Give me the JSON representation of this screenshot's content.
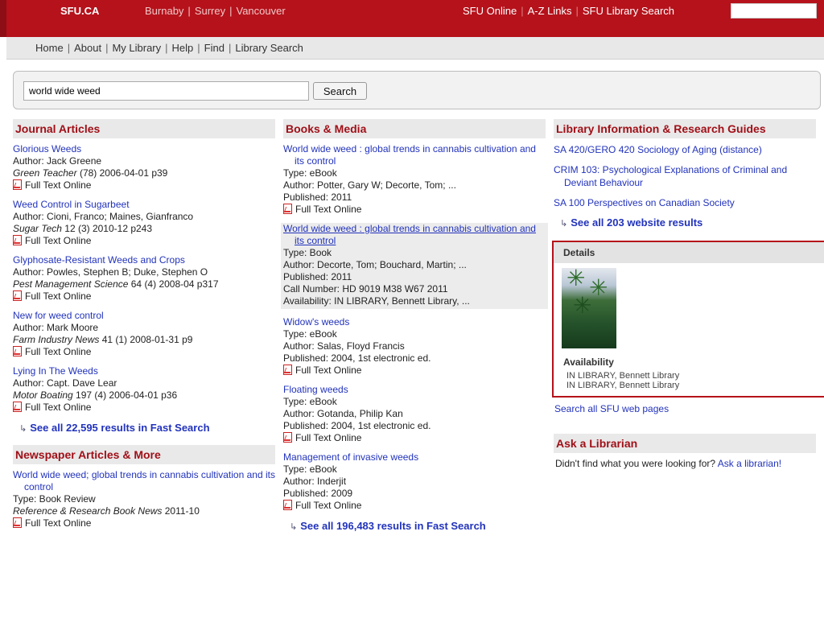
{
  "topbar": {
    "logo": "SFU.CA",
    "campuses": [
      "Burnaby",
      "Surrey",
      "Vancouver"
    ],
    "links": [
      "SFU Online",
      "A-Z Links",
      "SFU Library Search"
    ],
    "search_value": ""
  },
  "nav": [
    "Home",
    "About",
    "My Library",
    "Help",
    "Find",
    "Library Search"
  ],
  "search": {
    "query": "world wide weed",
    "button": "Search"
  },
  "journal": {
    "heading": "Journal Articles",
    "items": [
      {
        "title": "Glorious Weeds",
        "author": "Author: Jack Greene",
        "source_name": "Green Teacher",
        "source_rest": " (78) 2006-04-01 p39",
        "fulltext": "Full Text Online"
      },
      {
        "title": "Weed Control in Sugarbeet",
        "author": "Author: Cioni, Franco; Maines, Gianfranco",
        "source_name": "Sugar Tech",
        "source_rest": " 12 (3) 2010-12 p243",
        "fulltext": "Full Text Online"
      },
      {
        "title": "Glyphosate-Resistant Weeds and Crops",
        "author": "Author: Powles, Stephen B; Duke, Stephen O",
        "source_name": "Pest Management Science",
        "source_rest": " 64 (4) 2008-04 p317",
        "fulltext": "Full Text Online"
      },
      {
        "title": "New for weed control",
        "author": "Author: Mark Moore",
        "source_name": "Farm Industry News",
        "source_rest": " 41 (1) 2008-01-31 p9",
        "fulltext": "Full Text Online"
      },
      {
        "title": "Lying In The Weeds",
        "author": "Author: Capt. Dave Lear",
        "source_name": "Motor Boating",
        "source_rest": " 197 (4) 2006-04-01 p36",
        "fulltext": "Full Text Online"
      }
    ],
    "see_all": "See all 22,595 results in Fast Search"
  },
  "newspaper": {
    "heading": "Newspaper Articles & More",
    "item": {
      "title": "World wide weed; global trends in cannabis cultivation and its control",
      "type": "Type: Book Review",
      "source_name": "Reference & Research Book News",
      "source_rest": " 2011-10",
      "fulltext": "Full Text Online"
    }
  },
  "books": {
    "heading": "Books & Media",
    "items": [
      {
        "title": "World wide weed : global trends in cannabis cultivation and its control",
        "lines": [
          "Type: eBook",
          "Author: Potter, Gary W; Decorte, Tom; ...",
          "Published: 2011"
        ],
        "fulltext": "Full Text Online"
      },
      {
        "title": "World wide weed : global trends in cannabis cultivation and its control",
        "lines": [
          "Type: Book",
          "Author: Decorte, Tom; Bouchard, Martin; ...",
          "Published: 2011",
          "Call Number: HD 9019 M38 W67 2011",
          "Availability:  IN LIBRARY,  Bennett Library, ..."
        ]
      },
      {
        "title": "Widow's weeds",
        "lines": [
          "Type: eBook",
          "Author: Salas, Floyd Francis",
          "Published: 2004, 1st electronic ed."
        ],
        "fulltext": "Full Text Online"
      },
      {
        "title": "Floating weeds",
        "lines": [
          "Type: eBook",
          "Author: Gotanda, Philip Kan",
          "Published: 2004, 1st electronic ed."
        ],
        "fulltext": "Full Text Online"
      },
      {
        "title": "Management of invasive weeds",
        "lines": [
          "Type: eBook",
          "Author: Inderjit",
          "Published: 2009"
        ],
        "fulltext": "Full Text Online"
      }
    ],
    "see_all": "See all 196,483 results in Fast Search"
  },
  "guides": {
    "heading": "Library Information & Research Guides",
    "links": [
      "SA 420/GERO 420 Sociology of Aging (distance)",
      "CRIM 103: Psychological Explanations of Criminal and Deviant Behaviour",
      "SA 100 Perspectives on Canadian Society"
    ],
    "see_all": "See all 203 website results",
    "search_all": "Search all SFU web pages"
  },
  "details": {
    "heading": "Details",
    "availability_heading": "Availability",
    "availability": [
      "IN LIBRARY,  Bennett Library",
      "IN LIBRARY,  Bennett Library"
    ]
  },
  "ask": {
    "heading": "Ask a Librarian",
    "text": "Didn't find what you were looking for?",
    "link": "Ask a librarian!"
  }
}
